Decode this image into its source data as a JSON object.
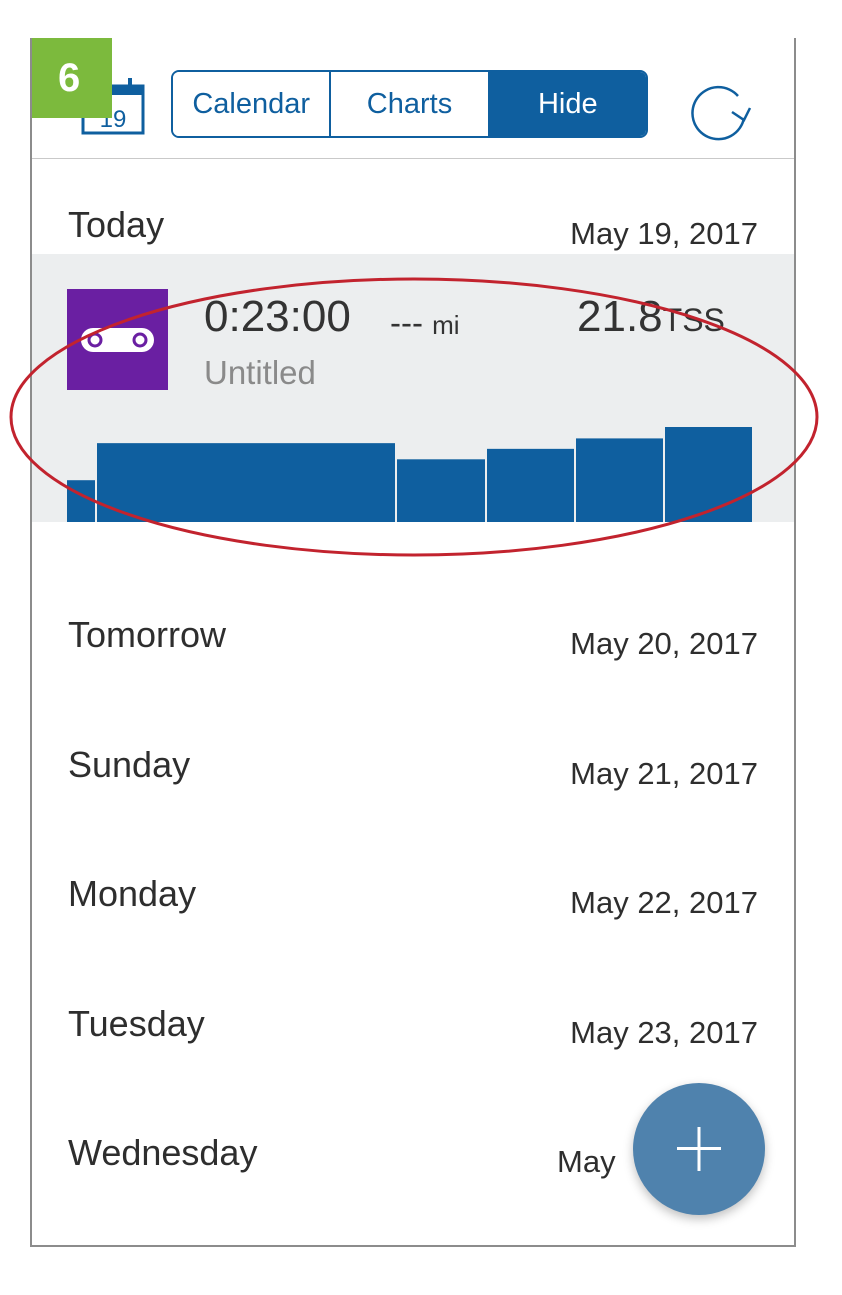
{
  "step_badge": "6",
  "calendar_icon": {
    "day": "19"
  },
  "tabs": [
    {
      "label": "Calendar",
      "active": false
    },
    {
      "label": "Charts",
      "active": false
    },
    {
      "label": "Hide",
      "active": true
    }
  ],
  "days": [
    {
      "name": "Today",
      "date": "May 19, 2017"
    },
    {
      "name": "Tomorrow",
      "date": "May 20, 2017"
    },
    {
      "name": "Sunday",
      "date": "May 21, 2017"
    },
    {
      "name": "Monday",
      "date": "May 22, 2017"
    },
    {
      "name": "Tuesday",
      "date": "May 23, 2017"
    },
    {
      "name": "Wednesday",
      "date": "May"
    }
  ],
  "workout": {
    "duration": "0:23:00",
    "distance": "---",
    "distance_unit": "mi",
    "tss": "21.8",
    "tss_unit": "TSS",
    "title": "Untitled",
    "icon": "bike-chain-link-icon",
    "interval_levels": [
      0.44,
      0.83,
      0.66,
      0.77,
      0.88,
      1.0
    ]
  },
  "colors": {
    "brand_blue": "#0f5f9f",
    "workout_purple": "#6a1fa2",
    "step_green": "#7cba3d",
    "annotation_red": "#c2232e",
    "fab_blue": "#4f82ad"
  }
}
